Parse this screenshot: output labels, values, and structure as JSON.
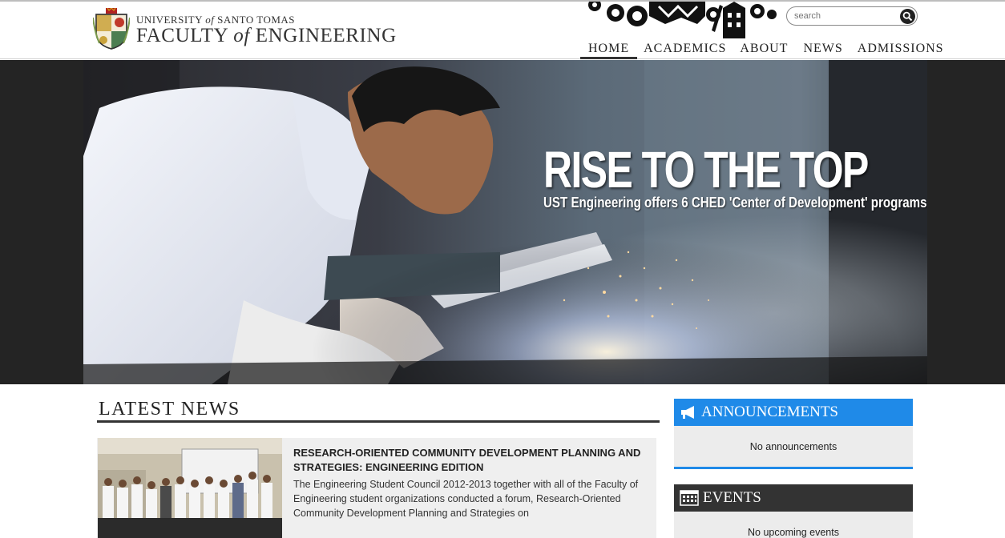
{
  "header": {
    "university": "UNIVERSITY of SANTO TOMAS",
    "faculty": "FACULTY of ENGINEERING",
    "search": {
      "placeholder": "search"
    }
  },
  "nav": {
    "items": [
      {
        "label": "HOME",
        "active": true
      },
      {
        "label": "ACADEMICS",
        "active": false
      },
      {
        "label": "ABOUT",
        "active": false
      },
      {
        "label": "NEWS",
        "active": false
      },
      {
        "label": "ADMISSIONS",
        "active": false
      }
    ]
  },
  "hero": {
    "title": "RISE TO THE TOP",
    "subtitle": "UST Engineering offers 6 CHED 'Center of Development' programs"
  },
  "news": {
    "heading": "LATEST NEWS",
    "items": [
      {
        "title": "RESEARCH-ORIENTED COMMUNITY DEVELOPMENT PLANNING AND STRATEGIES: ENGINEERING EDITION",
        "excerpt": "The Engineering Student Council 2012-2013 together with all of the Faculty of Engineering student organizations conducted a forum, Research-Oriented Community Development Planning and Strategies on"
      }
    ]
  },
  "sidebar": {
    "announcements": {
      "title": "ANNOUNCEMENTS",
      "empty": "No announcements",
      "icon": "megaphone-icon"
    },
    "events": {
      "title": "EVENTS",
      "empty": "No upcoming events",
      "icon": "calendar-icon"
    }
  },
  "colors": {
    "accent": "#1f8ae8",
    "events_header": "#333333",
    "hero_band": "#242424",
    "panel_bg": "#ececec"
  }
}
